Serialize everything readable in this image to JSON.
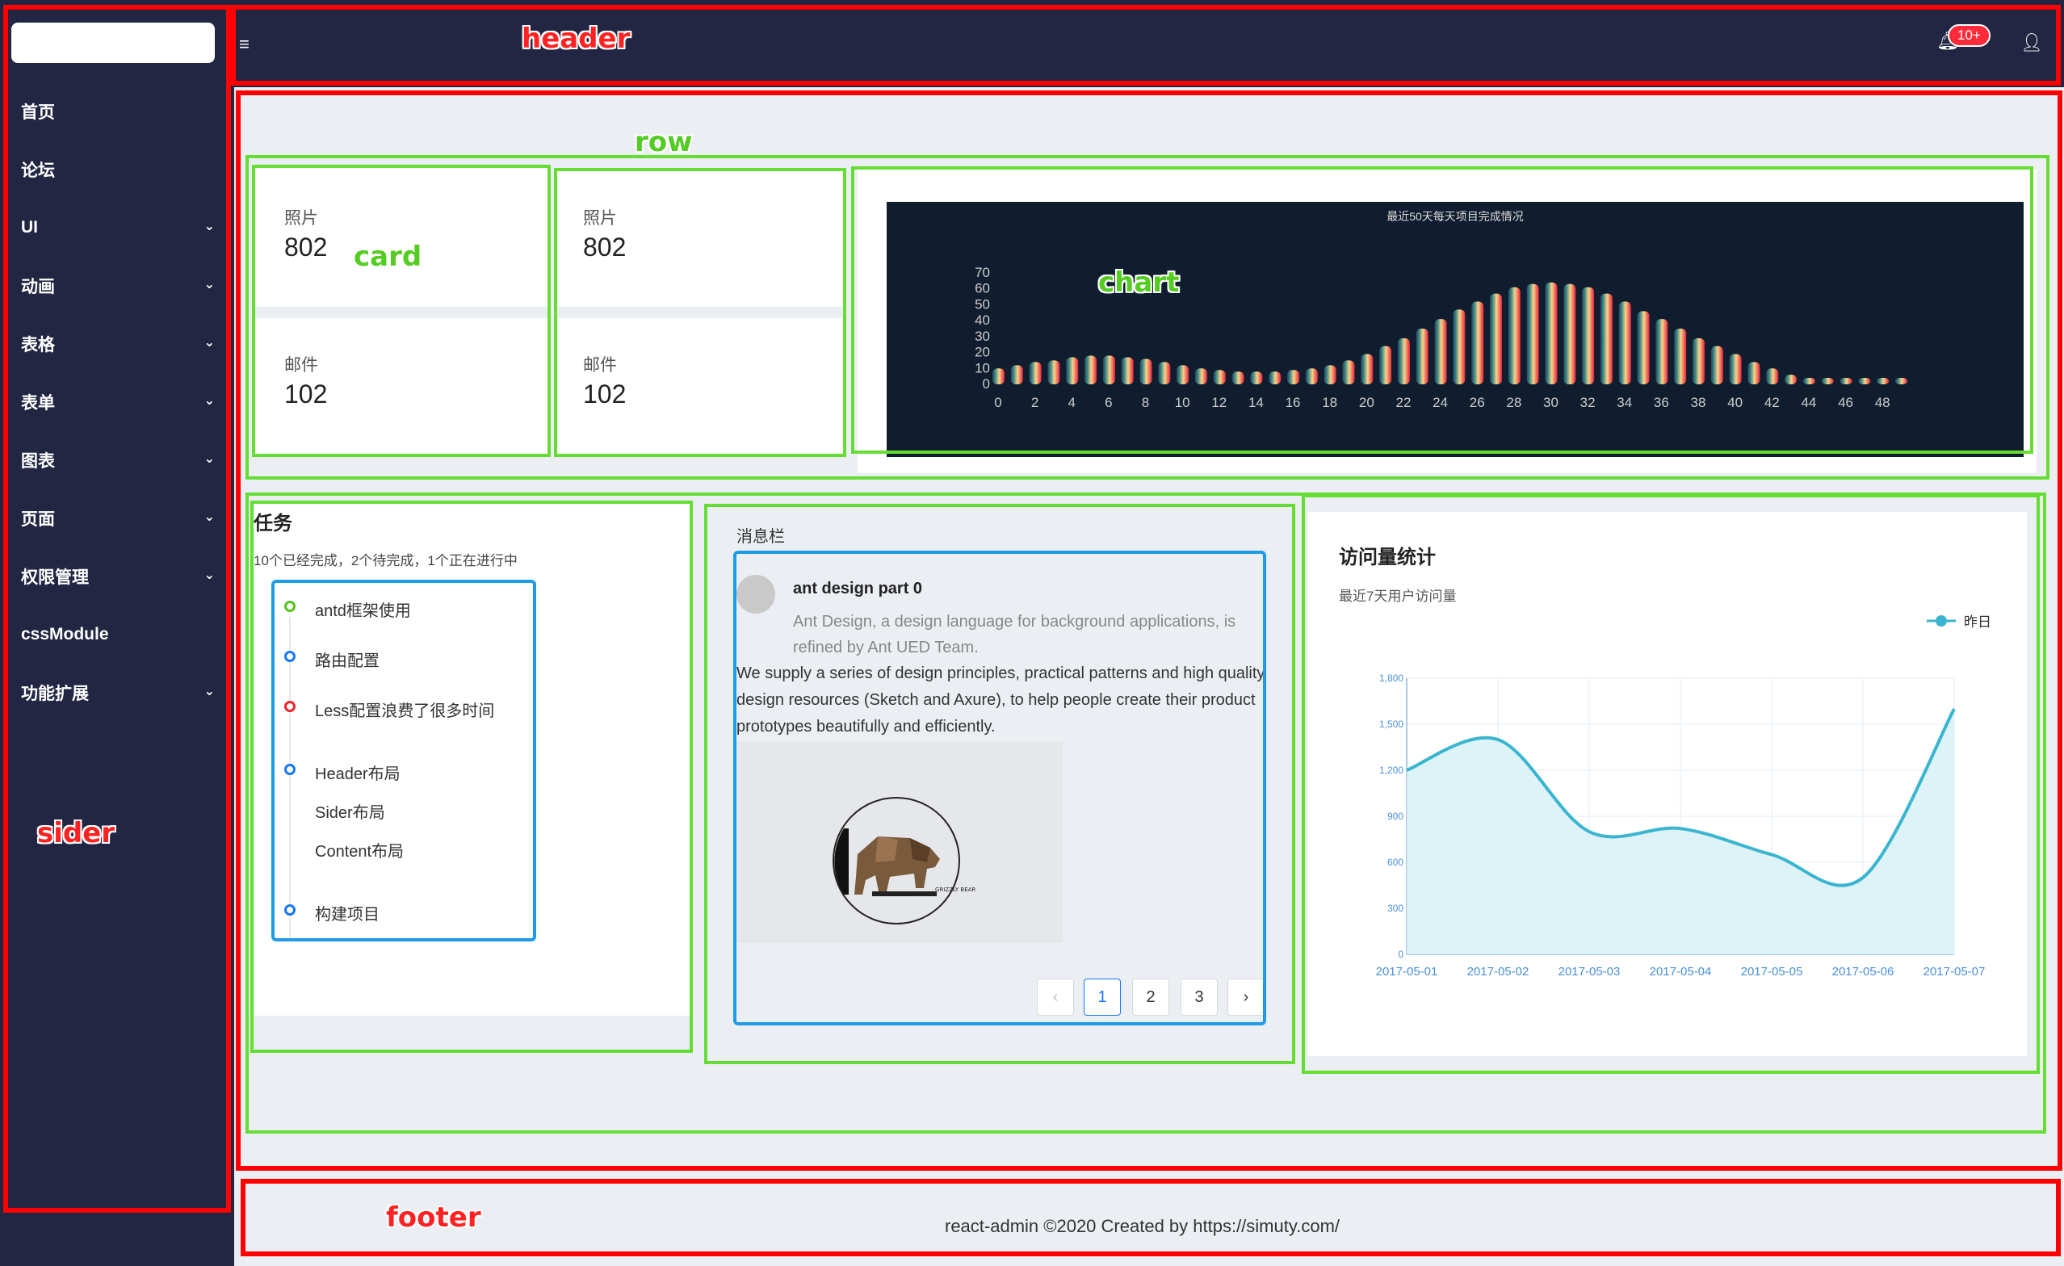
{
  "annotations": {
    "header": "header",
    "row": "row",
    "card": "card",
    "chart": "chart",
    "sider": "sider",
    "footer": "footer"
  },
  "header": {
    "menu_toggle_icon": "menu-fold-icon",
    "badge": "10+",
    "notification_icon": "bell-icon",
    "user_icon": "user-icon"
  },
  "sider": {
    "items": [
      {
        "label": "首页",
        "has_sub": false
      },
      {
        "label": "论坛",
        "has_sub": false
      },
      {
        "label": "UI",
        "has_sub": true
      },
      {
        "label": "动画",
        "has_sub": true
      },
      {
        "label": "表格",
        "has_sub": true
      },
      {
        "label": "表单",
        "has_sub": true
      },
      {
        "label": "图表",
        "has_sub": true
      },
      {
        "label": "页面",
        "has_sub": true
      },
      {
        "label": "权限管理",
        "has_sub": true
      },
      {
        "label": "cssModule",
        "has_sub": false
      },
      {
        "label": "功能扩展",
        "has_sub": true
      }
    ]
  },
  "cards": [
    {
      "photo_label": "照片",
      "photo_value": "802",
      "mail_label": "邮件",
      "mail_value": "102"
    },
    {
      "photo_label": "照片",
      "photo_value": "802",
      "mail_label": "邮件",
      "mail_value": "102"
    }
  ],
  "tasks": {
    "title": "任务",
    "subtitle": "10个已经完成，2个待完成，1个正在进行中",
    "items": [
      {
        "label": "antd框架使用",
        "color": "#52c41a"
      },
      {
        "label": "路由配置",
        "color": "#1677ff"
      },
      {
        "label": "Less配置浪费了很多时间",
        "color": "#f5222d"
      },
      {
        "label": "Header布局",
        "color": "#1677ff"
      },
      {
        "label": "Sider布局",
        "color": ""
      },
      {
        "label": "Content布局",
        "color": ""
      },
      {
        "label": "构建项目",
        "color": "#1677ff"
      }
    ]
  },
  "messages": {
    "title": "消息栏",
    "name": "ant design part 0",
    "description": "Ant Design, a design language for background applications, is refined by Ant UED Team.",
    "body": "We supply a series of design principles, practical patterns and high quality design resources (Sketch and Axure), to help people create their product prototypes beautifully and efficiently.",
    "image_caption": "GRIZZLY BEAR",
    "pagination": {
      "prev": "‹",
      "pages": [
        "1",
        "2",
        "3"
      ],
      "current": "1",
      "next": "›"
    }
  },
  "visits": {
    "title": "访问量统计",
    "subtitle": "最近7天用户访问量"
  },
  "footer": {
    "text": "react-admin ©2020 Created by https://simuty.com/"
  },
  "chart_data": [
    {
      "type": "bar",
      "title": "最近50天每天项目完成情况",
      "x": [
        0,
        1,
        2,
        3,
        4,
        5,
        6,
        7,
        8,
        9,
        10,
        11,
        12,
        13,
        14,
        15,
        16,
        17,
        18,
        19,
        20,
        21,
        22,
        23,
        24,
        25,
        26,
        27,
        28,
        29,
        30,
        31,
        32,
        33,
        34,
        35,
        36,
        37,
        38,
        39,
        40,
        41,
        42,
        43,
        44,
        45,
        46,
        47,
        48,
        49
      ],
      "x_tick_labels": [
        "0",
        "2",
        "4",
        "6",
        "8",
        "10",
        "12",
        "14",
        "16",
        "18",
        "20",
        "22",
        "24",
        "26",
        "28",
        "30",
        "32",
        "34",
        "36",
        "38",
        "40",
        "42",
        "44",
        "46",
        "48"
      ],
      "values": [
        10,
        12,
        14,
        15,
        17,
        18,
        18,
        17,
        16,
        14,
        12,
        10,
        9,
        8,
        8,
        8,
        9,
        10,
        12,
        15,
        19,
        24,
        29,
        35,
        41,
        47,
        52,
        57,
        61,
        63,
        64,
        63,
        61,
        57,
        52,
        46,
        41,
        35,
        29,
        24,
        19,
        14,
        10,
        6,
        4,
        3,
        2,
        2,
        2,
        2
      ],
      "ylim": [
        0,
        70
      ],
      "y_ticks": [
        0,
        10,
        20,
        30,
        40,
        50,
        60,
        70
      ],
      "colors": {
        "start": "#2c4560",
        "mid": "#f6d58a",
        "end": "#e8203a",
        "background": "#0f1d2e"
      }
    },
    {
      "type": "area",
      "categories": [
        "2017-05-01",
        "2017-05-02",
        "2017-05-03",
        "2017-05-04",
        "2017-05-05",
        "2017-05-06",
        "2017-05-07"
      ],
      "series": [
        {
          "name": "昨日",
          "values": [
            1200,
            1400,
            800,
            820,
            650,
            500,
            1600
          ]
        }
      ],
      "ylim": [
        0,
        1800
      ],
      "y_ticks": [
        "0",
        "300",
        "600",
        "900",
        "1,200",
        "1,500",
        "1,800"
      ],
      "colors": {
        "line": "#3ab5cf",
        "fill": "#d7f1f7"
      }
    }
  ]
}
